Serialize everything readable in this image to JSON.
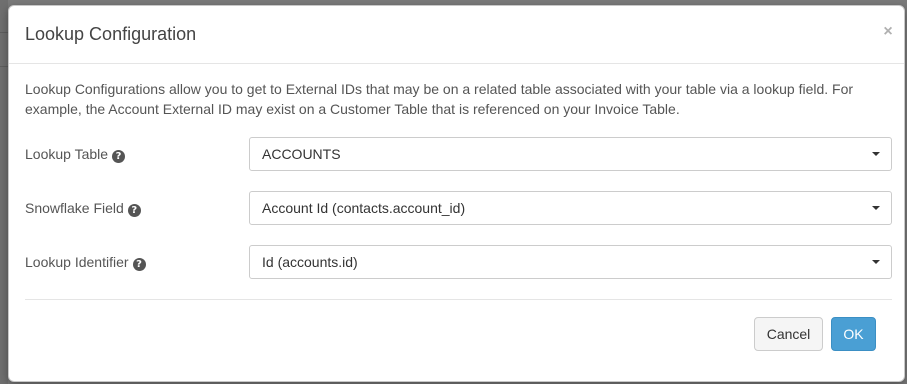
{
  "modal": {
    "title": "Lookup Configuration",
    "close_label": "×",
    "description": "Lookup Configurations allow you to get to External IDs that may be on a related table associated with your table via a lookup field. For example, the Account External ID may exist on a Customer Table that is referenced on your Invoice Table."
  },
  "fields": [
    {
      "label": "Lookup Table",
      "help_icon": "question-circle-icon",
      "value": "ACCOUNTS"
    },
    {
      "label": "Snowflake Field",
      "help_icon": "question-circle-icon",
      "value": "Account Id (contacts.account_id)"
    },
    {
      "label": "Lookup Identifier",
      "help_icon": "question-circle-icon",
      "value": "Id (accounts.id)"
    }
  ],
  "footer": {
    "cancel_label": "Cancel",
    "ok_label": "OK"
  },
  "colors": {
    "primary": "#4a9fd4",
    "backdrop": "#7a7a7a"
  }
}
